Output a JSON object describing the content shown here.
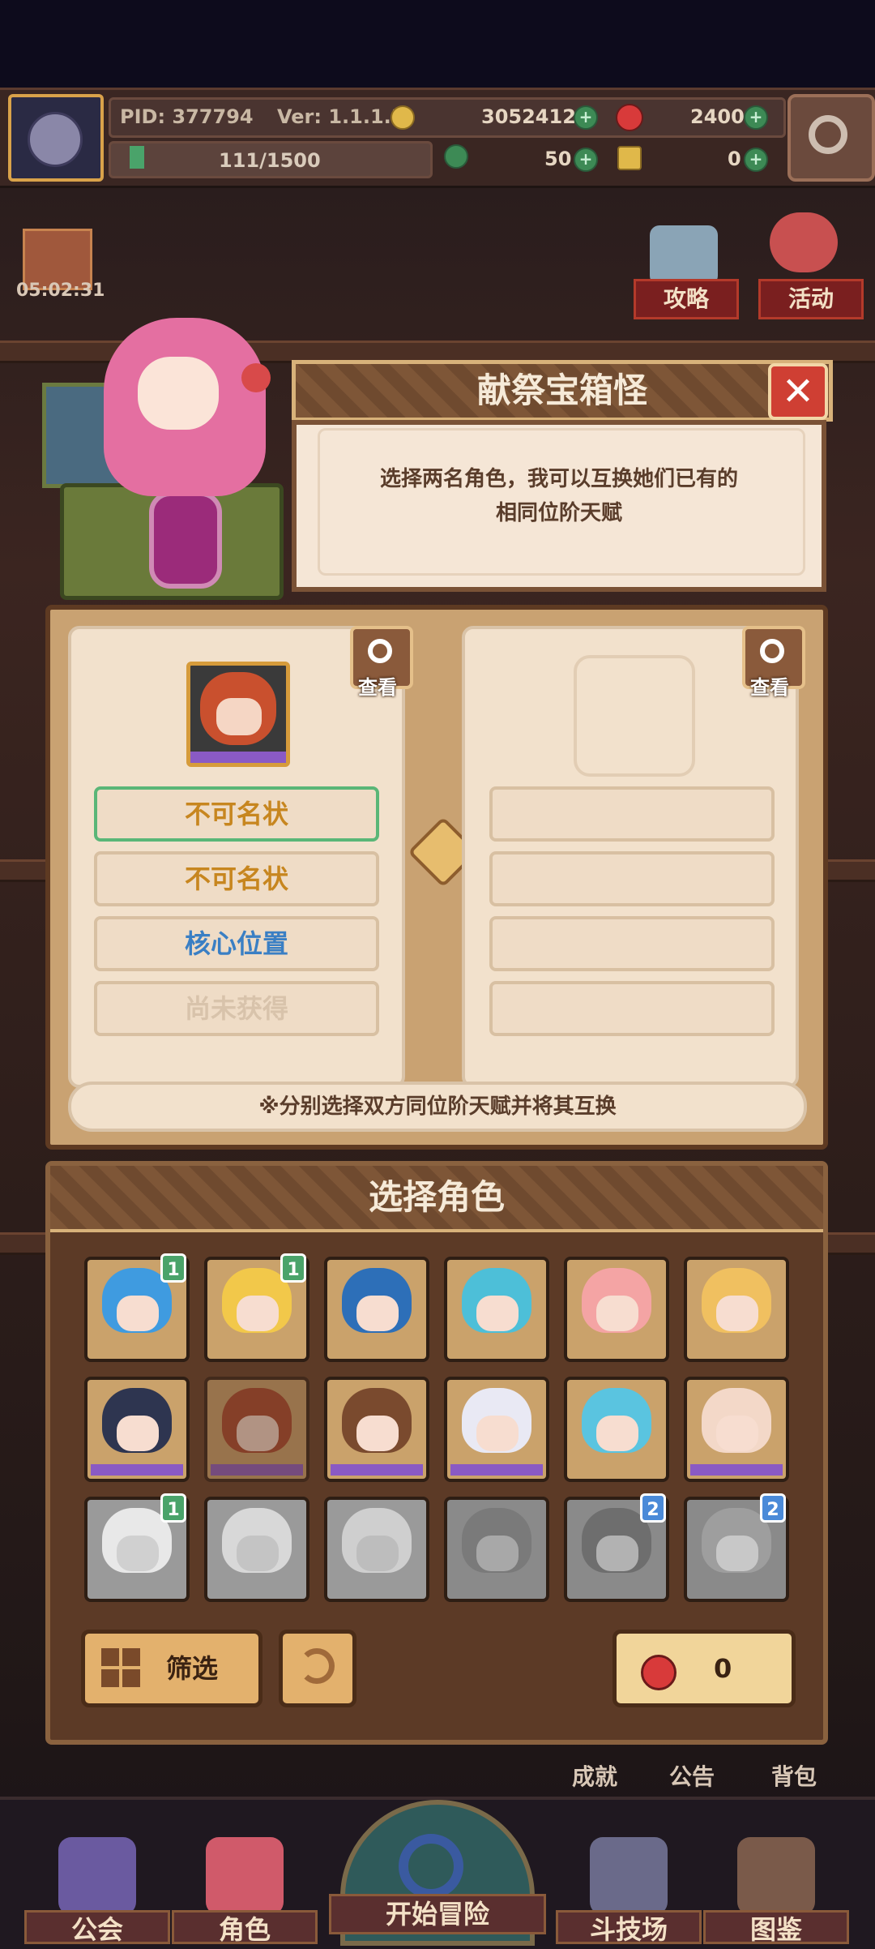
{
  "top_bar": {
    "pid": "PID: 377794",
    "version": "Ver: 1.1.1.3",
    "gold": "3052412",
    "gems": "2400",
    "stamina": "111/1500",
    "clover": "50",
    "keys": "0",
    "icons": {
      "avatar": "player-avatar",
      "gold": "gold-coin-icon",
      "gem": "red-gem-icon",
      "clover": "clover-icon",
      "key": "key-icon",
      "settings": "gear-icon"
    }
  },
  "side": {
    "timer": "05:02:31",
    "guide_label": "攻略",
    "activity_label": "活动"
  },
  "dialog": {
    "title": "献祭宝箱怪",
    "desc_line1": "选择两名角色，我可以互换她们已有的",
    "desc_line2": "相同位阶天赋",
    "close_icon": "close-icon"
  },
  "swap": {
    "view_label": "查看",
    "left_talents": [
      "不可名状",
      "不可名状",
      "核心位置",
      "尚未获得"
    ],
    "hint": "※分别选择双方同位阶天赋并将其互换"
  },
  "select": {
    "title": "选择角色",
    "filter_label": "筛选",
    "resource_count": "0",
    "badges": {
      "r0c0": "1",
      "r0c1": "1",
      "r2c0": "1",
      "r2c4": "2",
      "r2c5": "2"
    }
  },
  "menu_side": {
    "achievements": "成就",
    "notice": "公告",
    "bag": "背包"
  },
  "nav": {
    "guild": "公会",
    "character": "角色",
    "adventure": "开始冒险",
    "arena": "斗技场",
    "codex": "图鉴"
  },
  "colors": {
    "panel_border": "#5e3a22",
    "card_bg": "#f2e1cc",
    "talent_gold": "#c7861f",
    "talent_blue": "#3a7fc4",
    "talent_locked": "#d8c3ab",
    "selected_outline": "#5ab677"
  }
}
